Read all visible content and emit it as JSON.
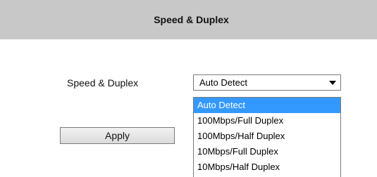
{
  "header": {
    "title": "Speed & Duplex"
  },
  "form": {
    "label": "Speed & Duplex",
    "select": {
      "value": "Auto Detect",
      "options": [
        "Auto Detect",
        "100Mbps/Full Duplex",
        "100Mbps/Half Duplex",
        "10Mbps/Full Duplex",
        "10Mbps/Half Duplex"
      ],
      "highlighted_index": 0
    },
    "apply_label": "Apply"
  },
  "colors": {
    "header_bg": "#c8c8c8",
    "highlight": "#3399ff"
  },
  "icons": {
    "select_arrow": "chevron-down-icon"
  }
}
